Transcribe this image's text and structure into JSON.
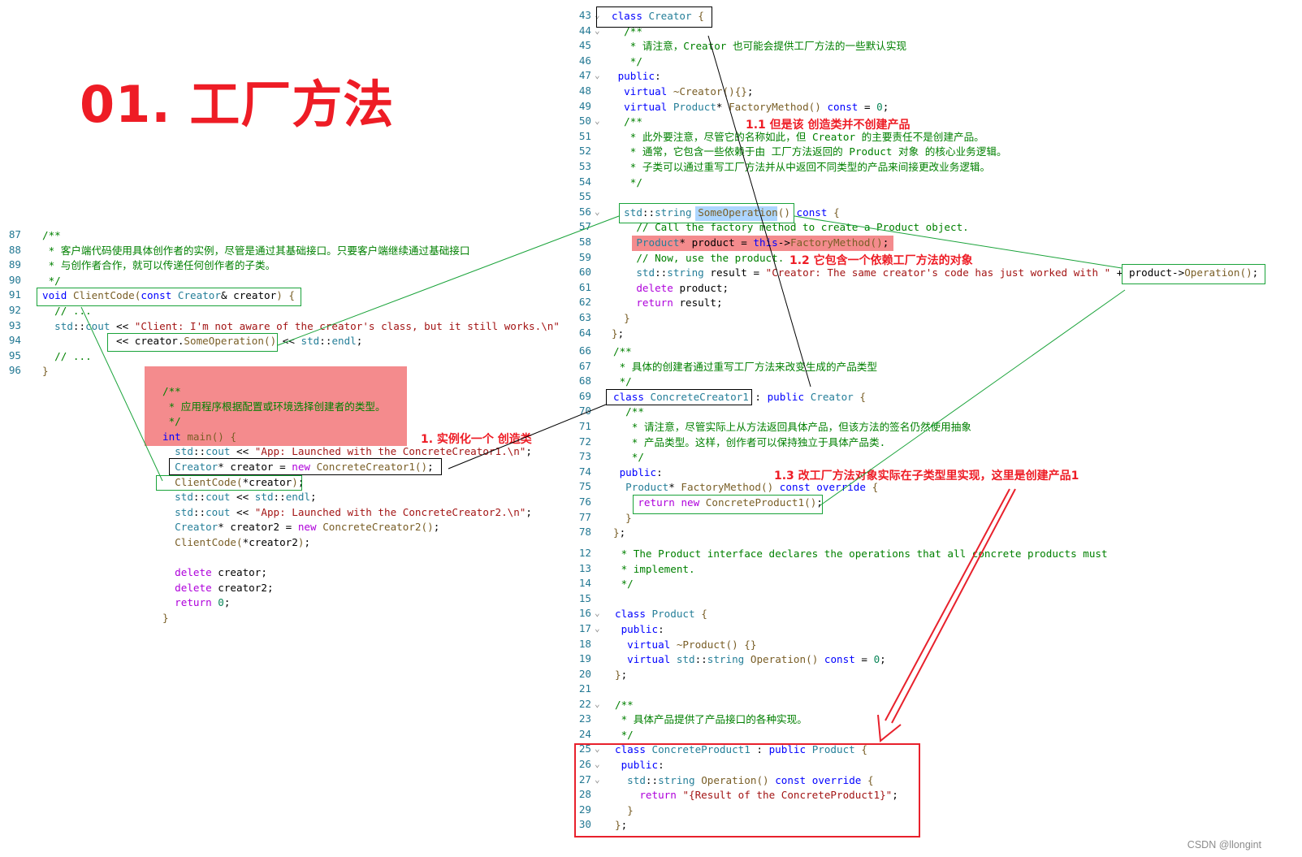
{
  "title": "01. 工厂方法",
  "watermark": "CSDN @llongint",
  "annotations": {
    "n1": "1. 实例化一个 创造类",
    "n11": "1.1 但是该 创造类并不创建产品",
    "n12": "1.2 它包含一个依赖工厂方法的对象",
    "n13": "1.3 改工厂方法对象实际在子类型里实现，这里是创建产品1"
  },
  "client_code": {
    "lines": [
      {
        "n": "87",
        "t": "/**"
      },
      {
        "n": "88",
        "t": " * 客户端代码使用具体创作者的实例，尽管是通过其基础接口。只要客户端继续通过基础接口"
      },
      {
        "n": "89",
        "t": " * 与创作者合作，就可以传递任何创作者的子类。"
      },
      {
        "n": "90",
        "t": " */"
      },
      {
        "n": "91",
        "t": "void ClientCode(const Creator& creator) {"
      },
      {
        "n": "92",
        "t": "  // ..."
      },
      {
        "n": "93",
        "t": "  std::cout << \"Client: I'm not aware of the creator's class, but it still works.\\n\""
      },
      {
        "n": "94",
        "t": "            << creator.SomeOperation() << std::endl;"
      },
      {
        "n": "95",
        "t": "  // ..."
      },
      {
        "n": "96",
        "t": "}"
      }
    ]
  },
  "main_code": {
    "lines": [
      "/**",
      " * 应用程序根据配置或环境选择创建者的类型。",
      " */",
      "int main() {",
      "  std::cout << \"App: Launched with the ConcreteCreator1.\\n\";",
      "  Creator* creator = new ConcreteCreator1();",
      "  ClientCode(*creator);",
      "  std::cout << std::endl;",
      "  std::cout << \"App: Launched with the ConcreteCreator2.\\n\";",
      "  Creator* creator2 = new ConcreteCreator2();",
      "  ClientCode(*creator2);",
      "",
      "  delete creator;",
      "  delete creator2;",
      "  return 0;",
      "}"
    ]
  },
  "creator_code": {
    "lines": [
      {
        "n": "43",
        "t": "class Creator {"
      },
      {
        "n": "44",
        "t": "  /**"
      },
      {
        "n": "45",
        "t": "   * 请注意，Creator 也可能会提供工厂方法的一些默认实现"
      },
      {
        "n": "46",
        "t": "   */"
      },
      {
        "n": "47",
        "t": " public:"
      },
      {
        "n": "48",
        "t": "  virtual ~Creator(){};"
      },
      {
        "n": "49",
        "t": "  virtual Product* FactoryMethod() const = 0;"
      },
      {
        "n": "50",
        "t": "  /**"
      },
      {
        "n": "51",
        "t": "   * 此外要注意，尽管它的名称如此，但 Creator 的主要责任不是创建产品。"
      },
      {
        "n": "52",
        "t": "   * 通常，它包含一些依赖于由 工厂方法返回的 Product 对象 的核心业务逻辑。"
      },
      {
        "n": "53",
        "t": "   * 子类可以通过重写工厂方法并从中返回不同类型的产品来间接更改业务逻辑。"
      },
      {
        "n": "54",
        "t": "   */"
      },
      {
        "n": "55",
        "t": ""
      },
      {
        "n": "56",
        "t": "  std::string SomeOperation() const {"
      },
      {
        "n": "57",
        "t": "    // Call the factory method to create a Product object."
      },
      {
        "n": "58",
        "t": "    Product* product = this->FactoryMethod();"
      },
      {
        "n": "59",
        "t": "    // Now, use the product."
      },
      {
        "n": "60",
        "t": "    std::string result = \"Creator: The same creator's code has just worked with \" + product->Operation();"
      },
      {
        "n": "61",
        "t": "    delete product;"
      },
      {
        "n": "62",
        "t": "    return result;"
      },
      {
        "n": "63",
        "t": "  }"
      },
      {
        "n": "64",
        "t": "};"
      }
    ]
  },
  "concrete_creator_code": {
    "lines": [
      {
        "n": "66",
        "t": "/**"
      },
      {
        "n": "67",
        "t": " * 具体的创建者通过重写工厂方法来改变生成的产品类型"
      },
      {
        "n": "68",
        "t": " */"
      },
      {
        "n": "69",
        "t": "class ConcreteCreator1 : public Creator {"
      },
      {
        "n": "70",
        "t": "  /**"
      },
      {
        "n": "71",
        "t": "   * 请注意，尽管实际上从方法返回具体产品，但该方法的签名仍然使用抽象"
      },
      {
        "n": "72",
        "t": "   * 产品类型。这样，创作者可以保持独立于具体产品类."
      },
      {
        "n": "73",
        "t": "   */"
      },
      {
        "n": "74",
        "t": " public:"
      },
      {
        "n": "75",
        "t": "  Product* FactoryMethod() const override {"
      },
      {
        "n": "76",
        "t": "    return new ConcreteProduct1();"
      },
      {
        "n": "77",
        "t": "  }"
      },
      {
        "n": "78",
        "t": "};"
      }
    ]
  },
  "product_code": {
    "lines": [
      {
        "n": "12",
        "t": " * The Product interface declares the operations that all concrete products must"
      },
      {
        "n": "13",
        "t": " * implement."
      },
      {
        "n": "14",
        "t": " */"
      },
      {
        "n": "15",
        "t": ""
      },
      {
        "n": "16",
        "t": "class Product {"
      },
      {
        "n": "17",
        "t": " public:"
      },
      {
        "n": "18",
        "t": "  virtual ~Product() {}"
      },
      {
        "n": "19",
        "t": "  virtual std::string Operation() const = 0;"
      },
      {
        "n": "20",
        "t": "};"
      }
    ]
  },
  "concrete_product_code": {
    "lines": [
      {
        "n": "21",
        "t": ""
      },
      {
        "n": "22",
        "t": "/**"
      },
      {
        "n": "23",
        "t": " * 具体产品提供了产品接口的各种实现。"
      },
      {
        "n": "24",
        "t": " */"
      },
      {
        "n": "25",
        "t": "class ConcreteProduct1 : public Product {"
      },
      {
        "n": "26",
        "t": " public:"
      },
      {
        "n": "27",
        "t": "  std::string Operation() const override {"
      },
      {
        "n": "28",
        "t": "    return \"{Result of the ConcreteProduct1}\";"
      },
      {
        "n": "29",
        "t": "  }"
      },
      {
        "n": "30",
        "t": "};"
      }
    ]
  },
  "colors": {
    "accent_red": "#ee1c25",
    "highlight_red": "#f48b8d",
    "box_green": "#1aa33a",
    "keyword_blue": "#0000ff",
    "comment_green": "#008000",
    "line_number": "#237893"
  }
}
